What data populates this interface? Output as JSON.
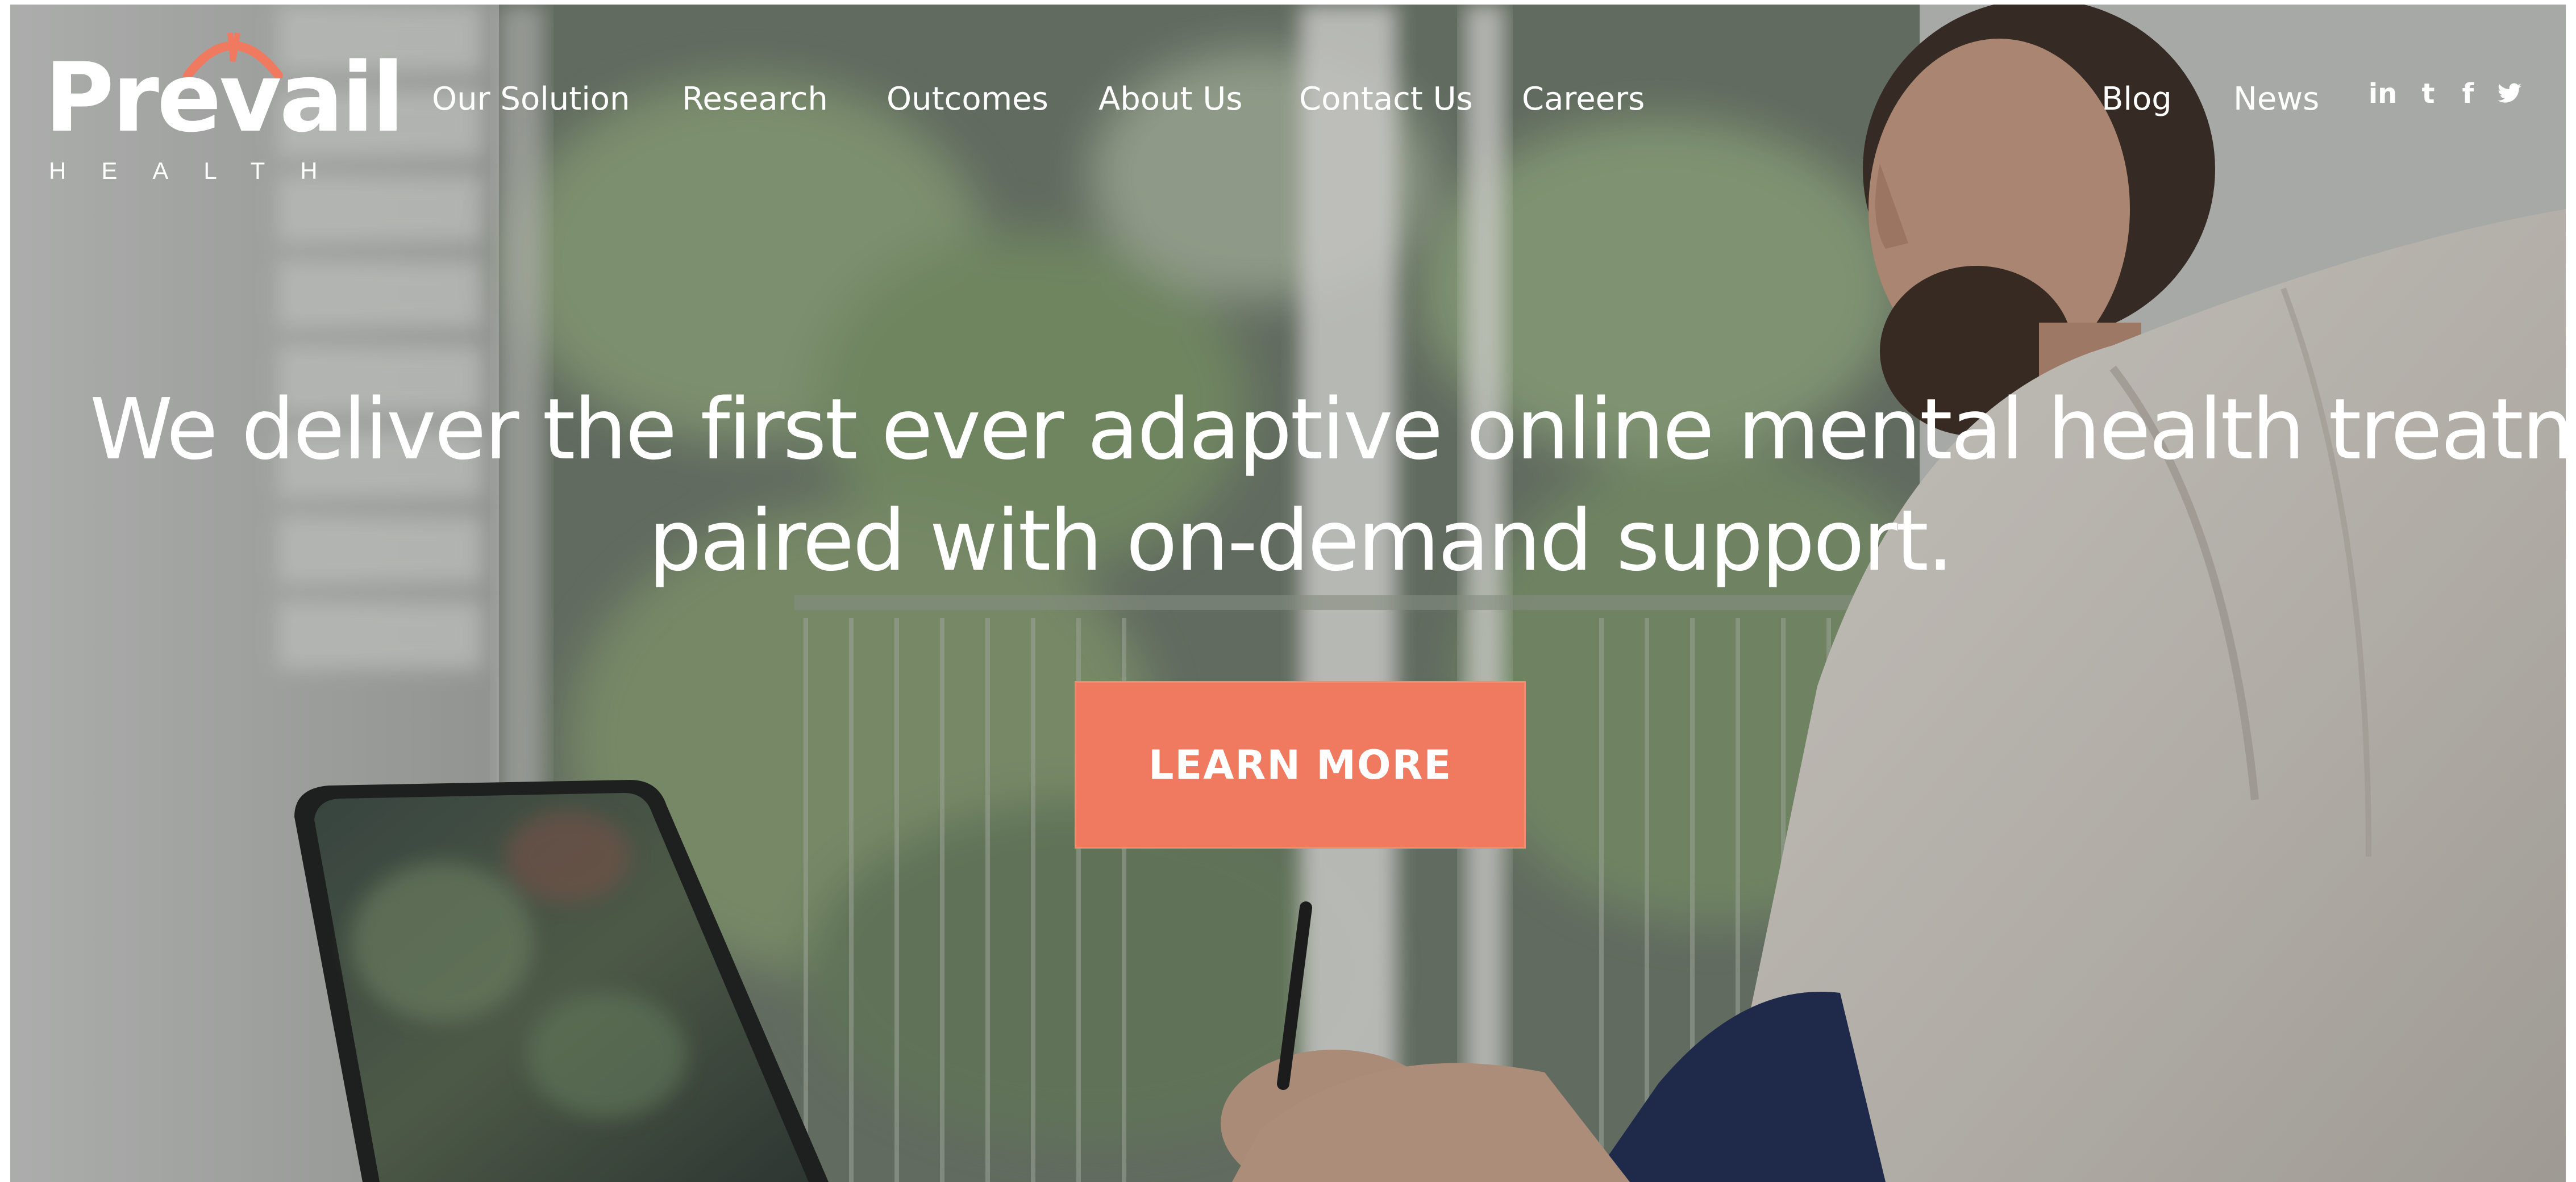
{
  "brand": {
    "name": "Prevail",
    "tagline": "HEALTH",
    "accent_color": "#ef7a60"
  },
  "nav": {
    "items": [
      {
        "label": "Our Solution"
      },
      {
        "label": "Research"
      },
      {
        "label": "Outcomes"
      },
      {
        "label": "About Us"
      },
      {
        "label": "Contact Us"
      },
      {
        "label": "Careers"
      },
      {
        "label": "Blog"
      },
      {
        "label": "News"
      }
    ]
  },
  "social": {
    "items": [
      {
        "label": "in",
        "icon": "linkedin-icon"
      },
      {
        "label": "t",
        "icon": "tumblr-icon"
      },
      {
        "label": "f",
        "icon": "facebook-icon"
      },
      {
        "label": "twitter",
        "icon": "twitter-icon"
      }
    ]
  },
  "hero": {
    "line1": "We deliver the first ever adaptive online mental health treatment,",
    "line2": "paired with on-demand support.",
    "cta_label": "LEARN MORE",
    "cta_color": "#ef7a60"
  }
}
